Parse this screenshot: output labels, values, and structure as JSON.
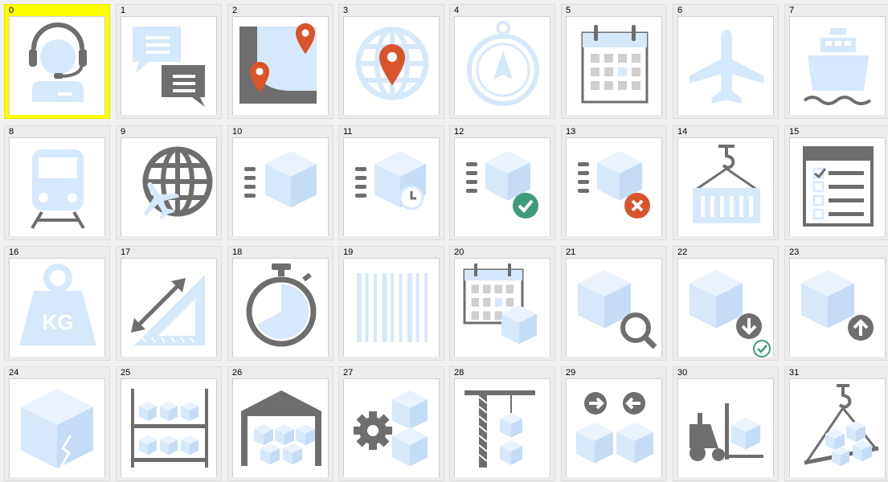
{
  "selected_index": 0,
  "colors": {
    "light_blue": "#d6e8fb",
    "gray": "#6e6e6e",
    "red_pin": "#d9532b",
    "green_check": "#3e9b7b",
    "red_x": "#d9532b",
    "selection": "#ffff00"
  },
  "icons": [
    {
      "id": "0",
      "name": "customer-service-icon"
    },
    {
      "id": "1",
      "name": "chat-icon"
    },
    {
      "id": "2",
      "name": "route-map-icon"
    },
    {
      "id": "3",
      "name": "globe-location-icon"
    },
    {
      "id": "4",
      "name": "compass-icon"
    },
    {
      "id": "5",
      "name": "calendar-icon"
    },
    {
      "id": "6",
      "name": "airplane-icon"
    },
    {
      "id": "7",
      "name": "ship-icon"
    },
    {
      "id": "8",
      "name": "train-icon"
    },
    {
      "id": "9",
      "name": "globe-airplane-icon"
    },
    {
      "id": "10",
      "name": "fast-delivery-box-icon"
    },
    {
      "id": "11",
      "name": "delivery-box-clock-icon"
    },
    {
      "id": "12",
      "name": "delivery-box-check-icon"
    },
    {
      "id": "13",
      "name": "delivery-box-cancel-icon"
    },
    {
      "id": "14",
      "name": "crane-container-icon"
    },
    {
      "id": "15",
      "name": "checklist-icon"
    },
    {
      "id": "16",
      "name": "weight-kg-icon"
    },
    {
      "id": "17",
      "name": "measure-ruler-icon"
    },
    {
      "id": "18",
      "name": "stopwatch-icon"
    },
    {
      "id": "19",
      "name": "barcode-icon"
    },
    {
      "id": "20",
      "name": "calendar-box-icon"
    },
    {
      "id": "21",
      "name": "box-search-icon"
    },
    {
      "id": "22",
      "name": "box-download-check-icon"
    },
    {
      "id": "23",
      "name": "box-upload-icon"
    },
    {
      "id": "24",
      "name": "damaged-box-icon"
    },
    {
      "id": "25",
      "name": "warehouse-shelf-icon"
    },
    {
      "id": "26",
      "name": "warehouse-icon"
    },
    {
      "id": "27",
      "name": "box-gear-icon"
    },
    {
      "id": "28",
      "name": "tower-crane-box-icon"
    },
    {
      "id": "29",
      "name": "box-exchange-icon"
    },
    {
      "id": "30",
      "name": "forklift-icon"
    },
    {
      "id": "31",
      "name": "hook-boxes-icon"
    }
  ],
  "badge_kg": "KG"
}
